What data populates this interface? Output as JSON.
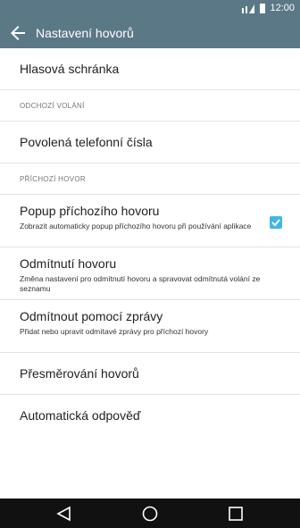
{
  "status": {
    "time": "12:00"
  },
  "header": {
    "title": "Nastavení hovorů"
  },
  "items": [
    {
      "label": "Hlasová schránka"
    },
    {
      "section": "ODCHOZÍ VOLÁNÍ"
    },
    {
      "label": "Povolená telefonní čísla"
    },
    {
      "section": "PŘÍCHOZÍ HOVOR"
    },
    {
      "label": "Popup příchozího hovoru",
      "sub": "Zobrazit automaticky popup příchozího hovoru při používání aplikace",
      "checked": true
    },
    {
      "label": "Odmítnutí hovoru",
      "sub": "Změna nastavení pro odmítnutí hovoru a spravovat odmítnutá volání ze seznamu"
    },
    {
      "label": "Odmítnout pomocí zprávy",
      "sub": "Přidat nebo upravit odmítavé zprávy pro příchozí hovory"
    },
    {
      "label": "Přesměrování hovorů"
    },
    {
      "label": "Automatická odpověď"
    }
  ],
  "colors": {
    "bar": "#5b7887",
    "accent": "#3fb7e8"
  },
  "icons": {
    "back": "arrow-left-icon",
    "nav": [
      "back-triangle-icon",
      "home-circle-icon",
      "recents-square-icon"
    ]
  }
}
